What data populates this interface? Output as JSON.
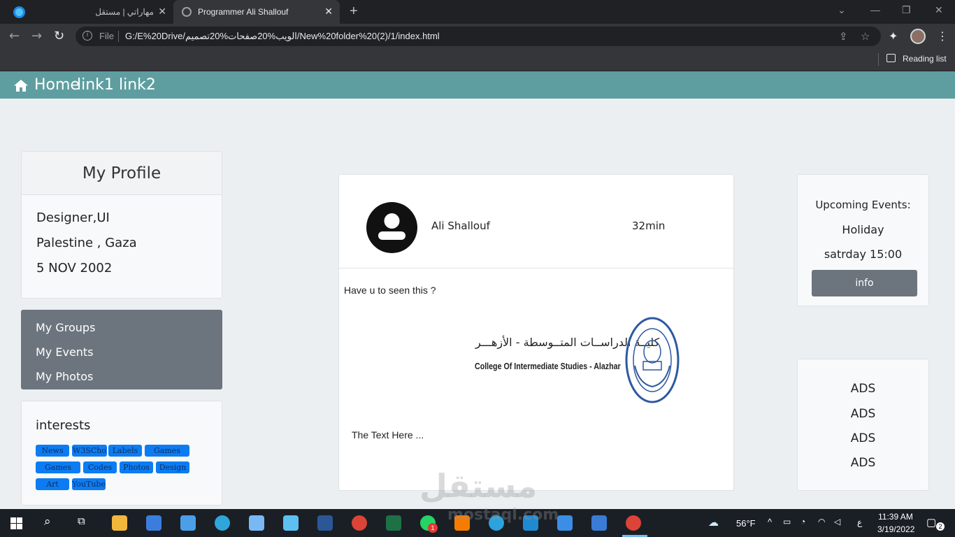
{
  "browser": {
    "tabs": [
      {
        "title": "مهاراتي | مستقل"
      },
      {
        "title": "Programmer Ali Shallouf"
      }
    ],
    "address": {
      "scheme_label": "File",
      "url": "G:/E%20Drive/الويب%20صفحات%20تصميم/New%20folder%20(2)/1/index.html"
    },
    "reading_list_label": "Reading list"
  },
  "site": {
    "nav": {
      "home_label": "Home",
      "link1_label": "link1",
      "link2_label": "link2"
    },
    "profile": {
      "title": "My Profile",
      "lines": [
        "Designer,UI",
        "Palestine , Gaza",
        "5 NOV 2002"
      ]
    },
    "menu": {
      "items": [
        "My Groups",
        "My Events",
        "My Photos"
      ]
    },
    "interests": {
      "title": "interests",
      "tags": [
        "News",
        "W3SCho",
        "Labels",
        "Games",
        "Games",
        "Codes",
        "Photos",
        "Design",
        "Art",
        "YouTube"
      ]
    },
    "post": {
      "author": "Ali Shallouf",
      "time": "32min",
      "question": "Have u to seen this ?",
      "logo_arabic": "كليــة الدراســات المتــوسطة - الأزهـــر",
      "logo_english": "College Of Intermediate Studies - Alazhar",
      "text": "The Text Here ..."
    },
    "events": {
      "title": "Upcoming Events:",
      "name": "Holiday",
      "when": "satrday  15:00",
      "button_label": "info"
    },
    "ads": {
      "items": [
        "ADS",
        "ADS",
        "ADS",
        "ADS"
      ]
    }
  },
  "watermark": {
    "arabic": "مستقل",
    "latin": "mostaql.com"
  },
  "taskbar": {
    "weather": "56°F",
    "lang": "ع",
    "time": "11:39 AM",
    "date": "3/19/2022",
    "notifications": "2",
    "whatsapp_badge": "1"
  },
  "colors": {
    "nav_bg": "#5f9ea0",
    "tag_bg": "#0d7cf2",
    "menu_bg": "#6c757d",
    "page_bg": "#eceff1"
  }
}
